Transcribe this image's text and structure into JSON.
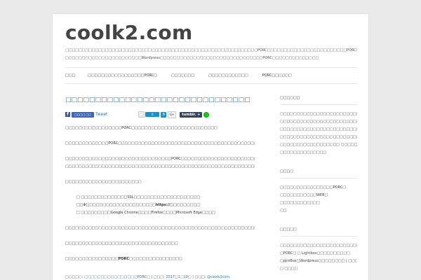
{
  "site": {
    "title": "coolk2.com",
    "description_lines": [
      "□□□□□□□□□□□□□□□□□□□□□□□□□□□□□□□□□□□□□□□□□□□□□□□□□□□□□□□□□□PORC□□□□□□□□□□□□□□□□□□□□□□□□PORC□□□□□□□□□□",
      "□□□□□□□□□□□□□□□□□□□□□□□Wordpress□□□□□□□□□□□□□□□□□□□□□□□□□□□□□□□PORC□□□□□□□□□□□□□□"
    ]
  },
  "nav": {
    "items": [
      "□□□",
      "□□□□□□□□□□□□□□□□□PORC□",
      "□□□□□□□",
      "□□□□□□□□□□□□",
      "PORC□□□□□□"
    ]
  },
  "post": {
    "title": "□□□□□□□□□□□□□□□□□□□□□□□□□□□□□□□",
    "share": {
      "fb_glyph": "f",
      "fb_like_label": "□□□□ □□",
      "tweet_label": "Tweet",
      "hatena_count": "0",
      "pocket_glyph": "8",
      "gplus_label": "G+",
      "tumblr_label": "tumblr. +",
      "line_glyph": "□"
    },
    "para1": "□□□□□□□□□□□□□□□□□PORC□□□□□□□□□□□□□□□□□□□□□□□□□□",
    "para2": "□□□□□□□□□□□□□PORC□□□□□□□□□□□□□□□□□□□□□□□□□□□□□□□□□□□□□□□□□□□□□□□□□□□□□",
    "para3_lines": [
      "□□□□□□□□□□□□□□□□□□□□□□□□□□□□□□□□PORC□□□□□□□□□□□□□□□□□□□□□□□□□□□□□□□□□□□□□□□□□□",
      "□□□□□□□□□□□□□□□□□□□□□□□□□□□□□□□□□□□□□□□□□□□□□□□□□□□□□□□□□□□□□"
    ],
    "para4": "□□□□□□□□□□□□□□□□□□□□□□□",
    "list": [
      "□ □□□□□□□□□□□□□□SSL□□□□□□□□□□□□□□□□□□□□",
      "□□✻□□□□□□□□□□□□□□□□□□□□□https://□□□□□□□□□",
      "□ □□□□□□□□□Google Chrome□□□□Firefox□□□□Microsoft Edge□□□□"
    ],
    "para5": "□□□□□□□□□□□□□□□□□□□□□□□□□□□□□□□□□□□□□□□□□□□□□□□□□□□□□□□□□□□□□□□□□□",
    "para6": "□□□□□□□□□□□□□□□□□□□□□□□□□□□□□□□□□□",
    "para7": "□□□□□□□□□□□□□□□□PORC□□□□□□□□□□□□□□□□",
    "meta": {
      "category_prefix": "□□□□□: ",
      "category": "□□□□□□□□□□□□□□□□PORC□",
      "date_prefix": " | □□□: ",
      "date": "2017□1□10□",
      "author_prefix": " | □□□: ",
      "author": "@coolk2com"
    }
  },
  "sidebar": {
    "widgets": [
      {
        "title": "□□□□□□",
        "lines": [
          "□□□□□□□□□□□□□□□□□□□□□□□□□",
          "□□□□□□□□□□□□□□□□□□□□□□□□□",
          "□□□□□□□□□□□□□□□□□□□□□□□□□",
          "□□□□□□□□□□□□□□□□□□□□□□□□",
          "□□□□□□□□□□□□□□□□□□ □□□□□□□□□□□",
          "□□□□□□□□□□□□□□"
        ]
      },
      {
        "title": "□□□□",
        "lines": [
          "□□□□□□□□□□□□□□□□PORC□",
          "□□□□□□□□□□□WEB□",
          "□□□□□□□□□□□□",
          "□□"
        ]
      },
      {
        "title": "□□□□□",
        "lines": [
          "□□□□□□□□□□□□□□□□□□□□□□□□□□□□□",
          "□PORC□ □ Lightbox□□□□□□□□□□",
          "□pjroBox□Wordpress□□□□□□□□ | □□□□□",
          "□ □□□□"
        ]
      }
    ]
  },
  "colors": {
    "link": "#2a7ab0",
    "background": "#e9e9e9",
    "page": "#ffffff"
  }
}
